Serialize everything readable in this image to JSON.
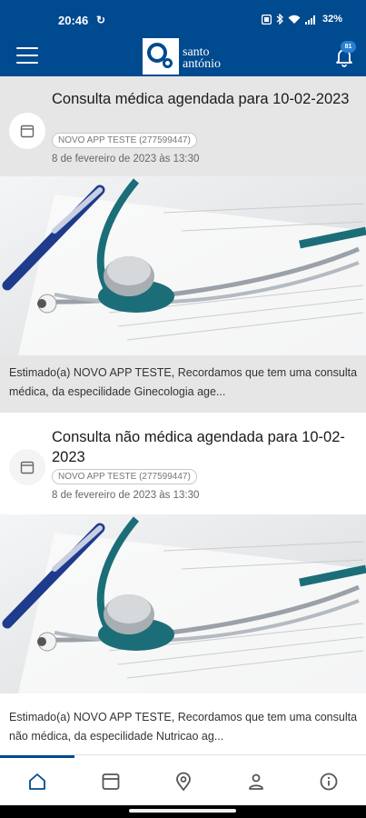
{
  "status_bar": {
    "time": "20:46",
    "battery": "32%"
  },
  "header": {
    "logo_line1": "santo",
    "logo_line2": "antónio",
    "notification_count": "81"
  },
  "notifications": [
    {
      "title": "Consulta médica agendada para 10-02-2023",
      "tag": "NOVO APP TESTE (277599447)",
      "date": "8 de fevereiro de 2023 às 13:30",
      "excerpt": "Estimado(a) NOVO APP TESTE, Recordamos que tem uma consulta médica, da especilidade Ginecologia age..."
    },
    {
      "title": "Consulta não médica agendada para 10-02-2023",
      "tag": "NOVO APP TESTE (277599447)",
      "date": "8 de fevereiro de 2023 às 13:30",
      "excerpt": "Estimado(a) NOVO APP TESTE, Recordamos que tem uma consulta não médica, da especilidade Nutricao ag..."
    }
  ],
  "bottom_nav": [
    {
      "icon": "home-icon",
      "active": true
    },
    {
      "icon": "calendar-icon",
      "active": false
    },
    {
      "icon": "location-pin-icon",
      "active": false
    },
    {
      "icon": "person-icon",
      "active": false
    },
    {
      "icon": "info-icon",
      "active": false
    }
  ],
  "colors": {
    "brand": "#004a8f",
    "read_background": "#ffffff",
    "unread_background": "#e6e6e6",
    "accent": "#2a7fd4"
  }
}
